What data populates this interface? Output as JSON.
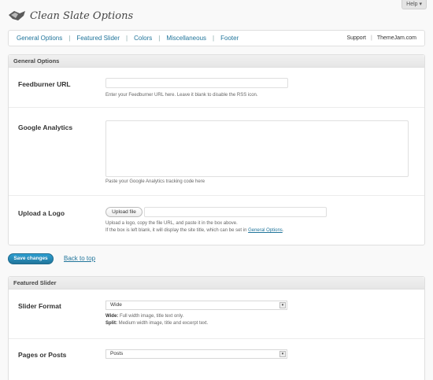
{
  "help": {
    "label": "Help ▾"
  },
  "header": {
    "title": "Clean Slate Options"
  },
  "nav": {
    "items": [
      "General Options",
      "Featured Slider",
      "Colors",
      "Miscellaneous",
      "Footer"
    ],
    "separator": "|",
    "support": "Support",
    "right_sep": "|",
    "themejam": "ThemeJam.com"
  },
  "general": {
    "heading": "General Options",
    "feedburner": {
      "label": "Feedburner URL",
      "value": "",
      "desc": "Enter your Feedburner URL here. Leave it blank to disable the RSS icon."
    },
    "analytics": {
      "label": "Google Analytics",
      "value": "",
      "desc": "Paste your Google Analytics tracking code here"
    },
    "logo": {
      "label": "Upload a Logo",
      "button": "Upload file",
      "value": "",
      "desc1": "Upload a logo, copy the file URL, and paste it in the box above.",
      "desc2_pre": "If the box is left blank, it will display the site title, which can be set in ",
      "desc2_link": "General Options",
      "desc2_post": "."
    }
  },
  "actions": {
    "save": "Save changes",
    "back": "Back to top"
  },
  "slider": {
    "heading": "Featured Slider",
    "format": {
      "label": "Slider Format",
      "selected": "Wide",
      "wide_key": "Wide:",
      "wide_desc": " Full width image, title text only.",
      "split_key": "Split:",
      "split_desc": " Medium width image, title and excerpt text."
    },
    "pages": {
      "label": "Pages or Posts",
      "selected": "Posts"
    }
  }
}
